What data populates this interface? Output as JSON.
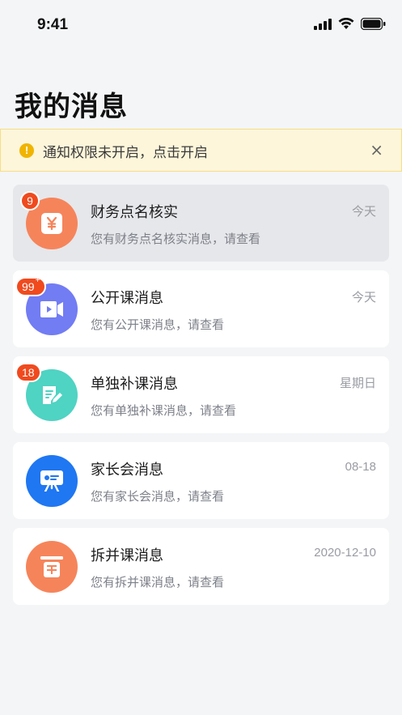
{
  "status_bar": {
    "time": "9:41"
  },
  "page": {
    "title": "我的消息"
  },
  "notice": {
    "text": "通知权限未开启，点击开启",
    "icon_text": "!",
    "close_label": "×"
  },
  "colors": {
    "finance": "#f6845a",
    "open_class": "#727cf3",
    "single_class": "#4fd3c3",
    "parent_meeting": "#1f77f2",
    "split_class": "#f6845a",
    "badge": "#f04a1e",
    "notice_bg": "#fdf6da"
  },
  "messages": [
    {
      "title": "财务点名核实",
      "subtitle": "您有财务点名核实消息，请查看",
      "time": "今天",
      "badge": "9",
      "icon": "yen-icon"
    },
    {
      "title": "公开课消息",
      "subtitle": "您有公开课消息，请查看",
      "time": "今天",
      "badge": "99",
      "badge_suffix": "+",
      "icon": "video-icon"
    },
    {
      "title": "单独补课消息",
      "subtitle": "您有单独补课消息，请查看",
      "time": "星期日",
      "badge": "18",
      "icon": "edit-doc-icon"
    },
    {
      "title": "家长会消息",
      "subtitle": "您有家长会消息，请查看",
      "time": "08-18",
      "icon": "presentation-icon"
    },
    {
      "title": "拆并课消息",
      "subtitle": "您有拆并课消息，请查看",
      "time": "2020-12-10",
      "icon": "merge-icon"
    }
  ]
}
